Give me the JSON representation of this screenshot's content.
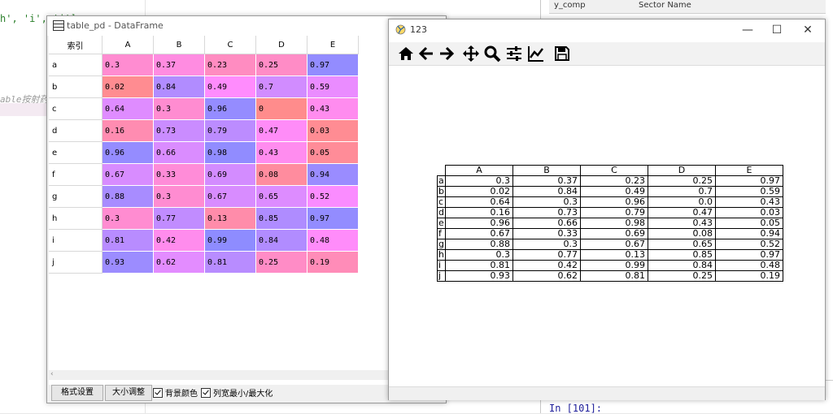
{
  "editor": {
    "code_line_1": "h', 'i', 'j']",
    "code_line_2": "able按射药"
  },
  "console": {
    "var_header_name": "y_comp",
    "var_header_value": "Sector Name",
    "prompt": "In [101]:"
  },
  "df_window": {
    "title": "table_pd - DataFrame",
    "index_header": "索引",
    "columns": [
      "A",
      "B",
      "C",
      "D",
      "E"
    ],
    "rows": [
      {
        "label": "a",
        "values": [
          "0.3",
          "0.37",
          "0.23",
          "0.25",
          "0.97"
        ]
      },
      {
        "label": "b",
        "values": [
          "0.02",
          "0.84",
          "0.49",
          "0.7",
          "0.59"
        ]
      },
      {
        "label": "c",
        "values": [
          "0.64",
          "0.3",
          "0.96",
          "0",
          "0.43"
        ]
      },
      {
        "label": "d",
        "values": [
          "0.16",
          "0.73",
          "0.79",
          "0.47",
          "0.03"
        ]
      },
      {
        "label": "e",
        "values": [
          "0.96",
          "0.66",
          "0.98",
          "0.43",
          "0.05"
        ]
      },
      {
        "label": "f",
        "values": [
          "0.67",
          "0.33",
          "0.69",
          "0.08",
          "0.94"
        ]
      },
      {
        "label": "g",
        "values": [
          "0.88",
          "0.3",
          "0.67",
          "0.65",
          "0.52"
        ]
      },
      {
        "label": "h",
        "values": [
          "0.3",
          "0.77",
          "0.13",
          "0.85",
          "0.97"
        ]
      },
      {
        "label": "i",
        "values": [
          "0.81",
          "0.42",
          "0.99",
          "0.84",
          "0.48"
        ]
      },
      {
        "label": "j",
        "values": [
          "0.93",
          "0.62",
          "0.81",
          "0.25",
          "0.19"
        ]
      }
    ],
    "buttons": {
      "format": "格式设置",
      "resize": "大小调整"
    },
    "checkboxes": {
      "background_color": "背景颜色",
      "column_min_max": "列宽最小/最大化"
    },
    "scroll_arrow": "‹"
  },
  "fig_window": {
    "title": "123",
    "window_buttons": {
      "minimize": "—",
      "maximize": "☐",
      "close": "✕"
    },
    "toolbar_icons": [
      "home-icon",
      "back-arrow-icon",
      "forward-arrow-icon",
      "pan-icon",
      "zoom-icon",
      "configure-subplots-icon",
      "edit-axis-icon",
      "save-icon"
    ],
    "table": {
      "columns": [
        "A",
        "B",
        "C",
        "D",
        "E"
      ],
      "rows": [
        {
          "label": "a",
          "values": [
            "0.3",
            "0.37",
            "0.23",
            "0.25",
            "0.97"
          ]
        },
        {
          "label": "b",
          "values": [
            "0.02",
            "0.84",
            "0.49",
            "0.7",
            "0.59"
          ]
        },
        {
          "label": "c",
          "values": [
            "0.64",
            "0.3",
            "0.96",
            "0.0",
            "0.43"
          ]
        },
        {
          "label": "d",
          "values": [
            "0.16",
            "0.73",
            "0.79",
            "0.47",
            "0.03"
          ]
        },
        {
          "label": "e",
          "values": [
            "0.96",
            "0.66",
            "0.98",
            "0.43",
            "0.05"
          ]
        },
        {
          "label": "f",
          "values": [
            "0.67",
            "0.33",
            "0.69",
            "0.08",
            "0.94"
          ]
        },
        {
          "label": "g",
          "values": [
            "0.88",
            "0.3",
            "0.67",
            "0.65",
            "0.52"
          ]
        },
        {
          "label": "h",
          "values": [
            "0.3",
            "0.77",
            "0.13",
            "0.85",
            "0.97"
          ]
        },
        {
          "label": "i",
          "values": [
            "0.81",
            "0.42",
            "0.99",
            "0.84",
            "0.48"
          ]
        },
        {
          "label": "j",
          "values": [
            "0.93",
            "0.62",
            "0.81",
            "0.25",
            "0.19"
          ]
        }
      ]
    }
  },
  "colors": {
    "low": "#ff8c8c",
    "mid": "#ff8cff",
    "high": "#8c8cff"
  }
}
